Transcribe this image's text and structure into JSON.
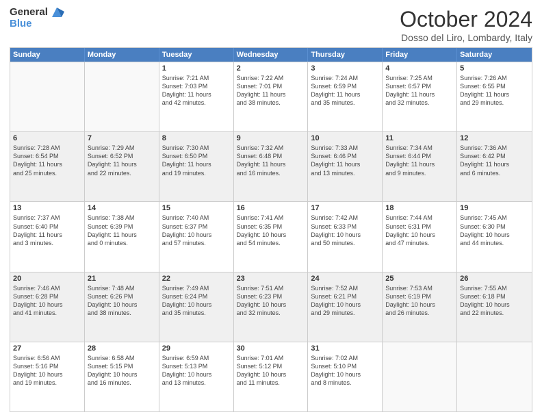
{
  "header": {
    "logo_general": "General",
    "logo_blue": "Blue",
    "month_title": "October 2024",
    "location": "Dosso del Liro, Lombardy, Italy"
  },
  "weekdays": [
    "Sunday",
    "Monday",
    "Tuesday",
    "Wednesday",
    "Thursday",
    "Friday",
    "Saturday"
  ],
  "rows": [
    [
      {
        "day": "",
        "lines": [],
        "empty": true
      },
      {
        "day": "",
        "lines": [],
        "empty": true
      },
      {
        "day": "1",
        "lines": [
          "Sunrise: 7:21 AM",
          "Sunset: 7:03 PM",
          "Daylight: 11 hours",
          "and 42 minutes."
        ]
      },
      {
        "day": "2",
        "lines": [
          "Sunrise: 7:22 AM",
          "Sunset: 7:01 PM",
          "Daylight: 11 hours",
          "and 38 minutes."
        ]
      },
      {
        "day": "3",
        "lines": [
          "Sunrise: 7:24 AM",
          "Sunset: 6:59 PM",
          "Daylight: 11 hours",
          "and 35 minutes."
        ]
      },
      {
        "day": "4",
        "lines": [
          "Sunrise: 7:25 AM",
          "Sunset: 6:57 PM",
          "Daylight: 11 hours",
          "and 32 minutes."
        ]
      },
      {
        "day": "5",
        "lines": [
          "Sunrise: 7:26 AM",
          "Sunset: 6:55 PM",
          "Daylight: 11 hours",
          "and 29 minutes."
        ]
      }
    ],
    [
      {
        "day": "6",
        "lines": [
          "Sunrise: 7:28 AM",
          "Sunset: 6:54 PM",
          "Daylight: 11 hours",
          "and 25 minutes."
        ],
        "shaded": true
      },
      {
        "day": "7",
        "lines": [
          "Sunrise: 7:29 AM",
          "Sunset: 6:52 PM",
          "Daylight: 11 hours",
          "and 22 minutes."
        ],
        "shaded": true
      },
      {
        "day": "8",
        "lines": [
          "Sunrise: 7:30 AM",
          "Sunset: 6:50 PM",
          "Daylight: 11 hours",
          "and 19 minutes."
        ],
        "shaded": true
      },
      {
        "day": "9",
        "lines": [
          "Sunrise: 7:32 AM",
          "Sunset: 6:48 PM",
          "Daylight: 11 hours",
          "and 16 minutes."
        ],
        "shaded": true
      },
      {
        "day": "10",
        "lines": [
          "Sunrise: 7:33 AM",
          "Sunset: 6:46 PM",
          "Daylight: 11 hours",
          "and 13 minutes."
        ],
        "shaded": true
      },
      {
        "day": "11",
        "lines": [
          "Sunrise: 7:34 AM",
          "Sunset: 6:44 PM",
          "Daylight: 11 hours",
          "and 9 minutes."
        ],
        "shaded": true
      },
      {
        "day": "12",
        "lines": [
          "Sunrise: 7:36 AM",
          "Sunset: 6:42 PM",
          "Daylight: 11 hours",
          "and 6 minutes."
        ],
        "shaded": true
      }
    ],
    [
      {
        "day": "13",
        "lines": [
          "Sunrise: 7:37 AM",
          "Sunset: 6:40 PM",
          "Daylight: 11 hours",
          "and 3 minutes."
        ]
      },
      {
        "day": "14",
        "lines": [
          "Sunrise: 7:38 AM",
          "Sunset: 6:39 PM",
          "Daylight: 11 hours",
          "and 0 minutes."
        ]
      },
      {
        "day": "15",
        "lines": [
          "Sunrise: 7:40 AM",
          "Sunset: 6:37 PM",
          "Daylight: 10 hours",
          "and 57 minutes."
        ]
      },
      {
        "day": "16",
        "lines": [
          "Sunrise: 7:41 AM",
          "Sunset: 6:35 PM",
          "Daylight: 10 hours",
          "and 54 minutes."
        ]
      },
      {
        "day": "17",
        "lines": [
          "Sunrise: 7:42 AM",
          "Sunset: 6:33 PM",
          "Daylight: 10 hours",
          "and 50 minutes."
        ]
      },
      {
        "day": "18",
        "lines": [
          "Sunrise: 7:44 AM",
          "Sunset: 6:31 PM",
          "Daylight: 10 hours",
          "and 47 minutes."
        ]
      },
      {
        "day": "19",
        "lines": [
          "Sunrise: 7:45 AM",
          "Sunset: 6:30 PM",
          "Daylight: 10 hours",
          "and 44 minutes."
        ]
      }
    ],
    [
      {
        "day": "20",
        "lines": [
          "Sunrise: 7:46 AM",
          "Sunset: 6:28 PM",
          "Daylight: 10 hours",
          "and 41 minutes."
        ],
        "shaded": true
      },
      {
        "day": "21",
        "lines": [
          "Sunrise: 7:48 AM",
          "Sunset: 6:26 PM",
          "Daylight: 10 hours",
          "and 38 minutes."
        ],
        "shaded": true
      },
      {
        "day": "22",
        "lines": [
          "Sunrise: 7:49 AM",
          "Sunset: 6:24 PM",
          "Daylight: 10 hours",
          "and 35 minutes."
        ],
        "shaded": true
      },
      {
        "day": "23",
        "lines": [
          "Sunrise: 7:51 AM",
          "Sunset: 6:23 PM",
          "Daylight: 10 hours",
          "and 32 minutes."
        ],
        "shaded": true
      },
      {
        "day": "24",
        "lines": [
          "Sunrise: 7:52 AM",
          "Sunset: 6:21 PM",
          "Daylight: 10 hours",
          "and 29 minutes."
        ],
        "shaded": true
      },
      {
        "day": "25",
        "lines": [
          "Sunrise: 7:53 AM",
          "Sunset: 6:19 PM",
          "Daylight: 10 hours",
          "and 26 minutes."
        ],
        "shaded": true
      },
      {
        "day": "26",
        "lines": [
          "Sunrise: 7:55 AM",
          "Sunset: 6:18 PM",
          "Daylight: 10 hours",
          "and 22 minutes."
        ],
        "shaded": true
      }
    ],
    [
      {
        "day": "27",
        "lines": [
          "Sunrise: 6:56 AM",
          "Sunset: 5:16 PM",
          "Daylight: 10 hours",
          "and 19 minutes."
        ]
      },
      {
        "day": "28",
        "lines": [
          "Sunrise: 6:58 AM",
          "Sunset: 5:15 PM",
          "Daylight: 10 hours",
          "and 16 minutes."
        ]
      },
      {
        "day": "29",
        "lines": [
          "Sunrise: 6:59 AM",
          "Sunset: 5:13 PM",
          "Daylight: 10 hours",
          "and 13 minutes."
        ]
      },
      {
        "day": "30",
        "lines": [
          "Sunrise: 7:01 AM",
          "Sunset: 5:12 PM",
          "Daylight: 10 hours",
          "and 11 minutes."
        ]
      },
      {
        "day": "31",
        "lines": [
          "Sunrise: 7:02 AM",
          "Sunset: 5:10 PM",
          "Daylight: 10 hours",
          "and 8 minutes."
        ]
      },
      {
        "day": "",
        "lines": [],
        "empty": true
      },
      {
        "day": "",
        "lines": [],
        "empty": true
      }
    ]
  ]
}
